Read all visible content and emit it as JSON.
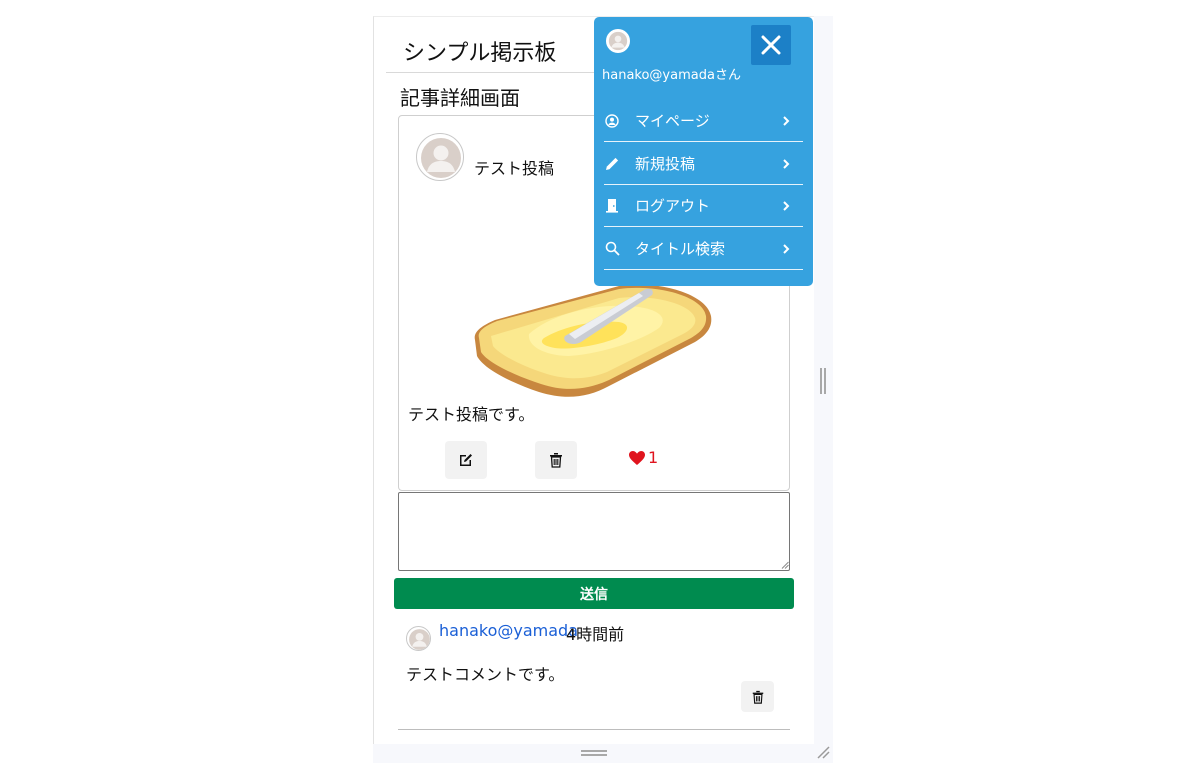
{
  "app": {
    "title": "シンプル掲示板"
  },
  "page": {
    "heading": "記事詳細画面"
  },
  "post": {
    "title": "テスト投稿",
    "body": "テスト投稿です。",
    "like_count": "1"
  },
  "comment_form": {
    "placeholder": "",
    "value": "",
    "submit_label": "送信"
  },
  "comments": [
    {
      "user": "hanako@yamada",
      "time": "4時間前",
      "body": "テストコメントです。"
    }
  ],
  "drawer": {
    "user_label": "hanako@yamadaさん",
    "items": [
      {
        "label": "マイページ",
        "icon": "user-circle-icon"
      },
      {
        "label": "新規投稿",
        "icon": "pencil-icon"
      },
      {
        "label": "ログアウト",
        "icon": "door-icon"
      },
      {
        "label": "タイトル検索",
        "icon": "search-icon"
      }
    ]
  },
  "colors": {
    "drawer_bg": "#36a2df",
    "close_bg": "#1c80c7",
    "send_bg": "#008b4f",
    "link": "#1a5fd6",
    "like": "#e0141e"
  }
}
